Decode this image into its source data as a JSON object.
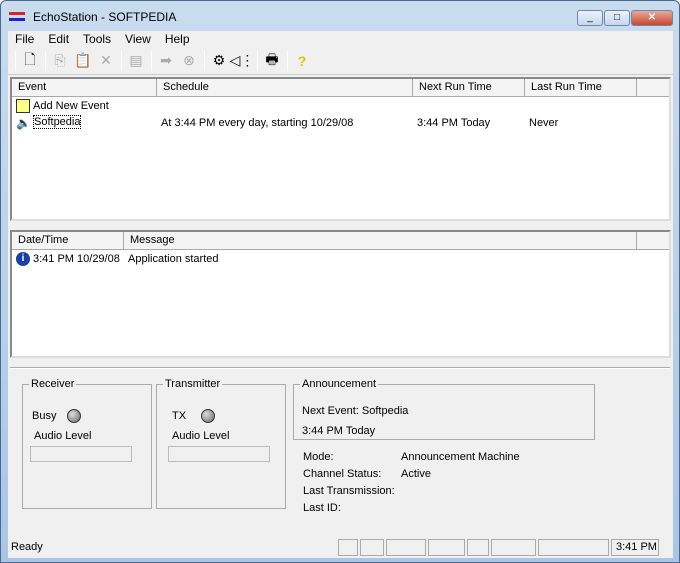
{
  "window": {
    "title": "EchoStation - SOFTPEDIA",
    "controls": [
      "minimize",
      "maximize",
      "close"
    ]
  },
  "menu": [
    "File",
    "Edit",
    "Tools",
    "View",
    "Help"
  ],
  "toolbar": [
    {
      "icon": "new-icon",
      "enabled": true
    },
    {
      "sep": true
    },
    {
      "icon": "copy-icon",
      "enabled": false
    },
    {
      "icon": "paste-icon",
      "enabled": false
    },
    {
      "icon": "delete-icon",
      "enabled": false
    },
    {
      "sep": true
    },
    {
      "icon": "properties-icon",
      "enabled": false
    },
    {
      "sep": true
    },
    {
      "icon": "run-icon",
      "enabled": false
    },
    {
      "icon": "stop-icon",
      "enabled": false
    },
    {
      "sep": true
    },
    {
      "icon": "settings-icon",
      "enabled": true
    },
    {
      "icon": "audio-icon",
      "enabled": true
    },
    {
      "sep": true
    },
    {
      "icon": "print-icon",
      "enabled": true
    },
    {
      "sep": true
    },
    {
      "icon": "help-icon",
      "enabled": true
    }
  ],
  "events": {
    "columns": [
      "Event",
      "Schedule",
      "Next Run Time",
      "Last Run Time"
    ],
    "rows": [
      {
        "event": "Add New Event",
        "schedule": "",
        "next": "",
        "last": "",
        "icon": "add-event-icon"
      },
      {
        "event": "Softpedia",
        "schedule": "At 3:44 PM every day, starting 10/29/08",
        "next": "3:44 PM Today",
        "last": "Never",
        "icon": "speaker-icon"
      }
    ]
  },
  "log": {
    "columns": [
      "Date/Time",
      "Message"
    ],
    "rows": [
      {
        "datetime": "3:41 PM 10/29/08",
        "message": "Application started",
        "icon": "info-icon"
      }
    ]
  },
  "receiver": {
    "title": "Receiver",
    "busy": "Busy",
    "audio_level": "Audio Level"
  },
  "transmitter": {
    "title": "Transmitter",
    "tx": "TX",
    "audio_level": "Audio Level"
  },
  "announcement": {
    "title": "Announcement",
    "next_event": "Next Event: Softpedia",
    "time": "3:44 PM Today"
  },
  "info": {
    "mode_label": "Mode:",
    "mode": "Announcement Machine",
    "channel_label": "Channel Status:",
    "channel": "Active",
    "last_tx_label": "Last Transmission:",
    "last_tx": "",
    "last_id_label": "Last ID:",
    "last_id": ""
  },
  "status": {
    "text": "Ready",
    "clock": "3:41 PM"
  }
}
